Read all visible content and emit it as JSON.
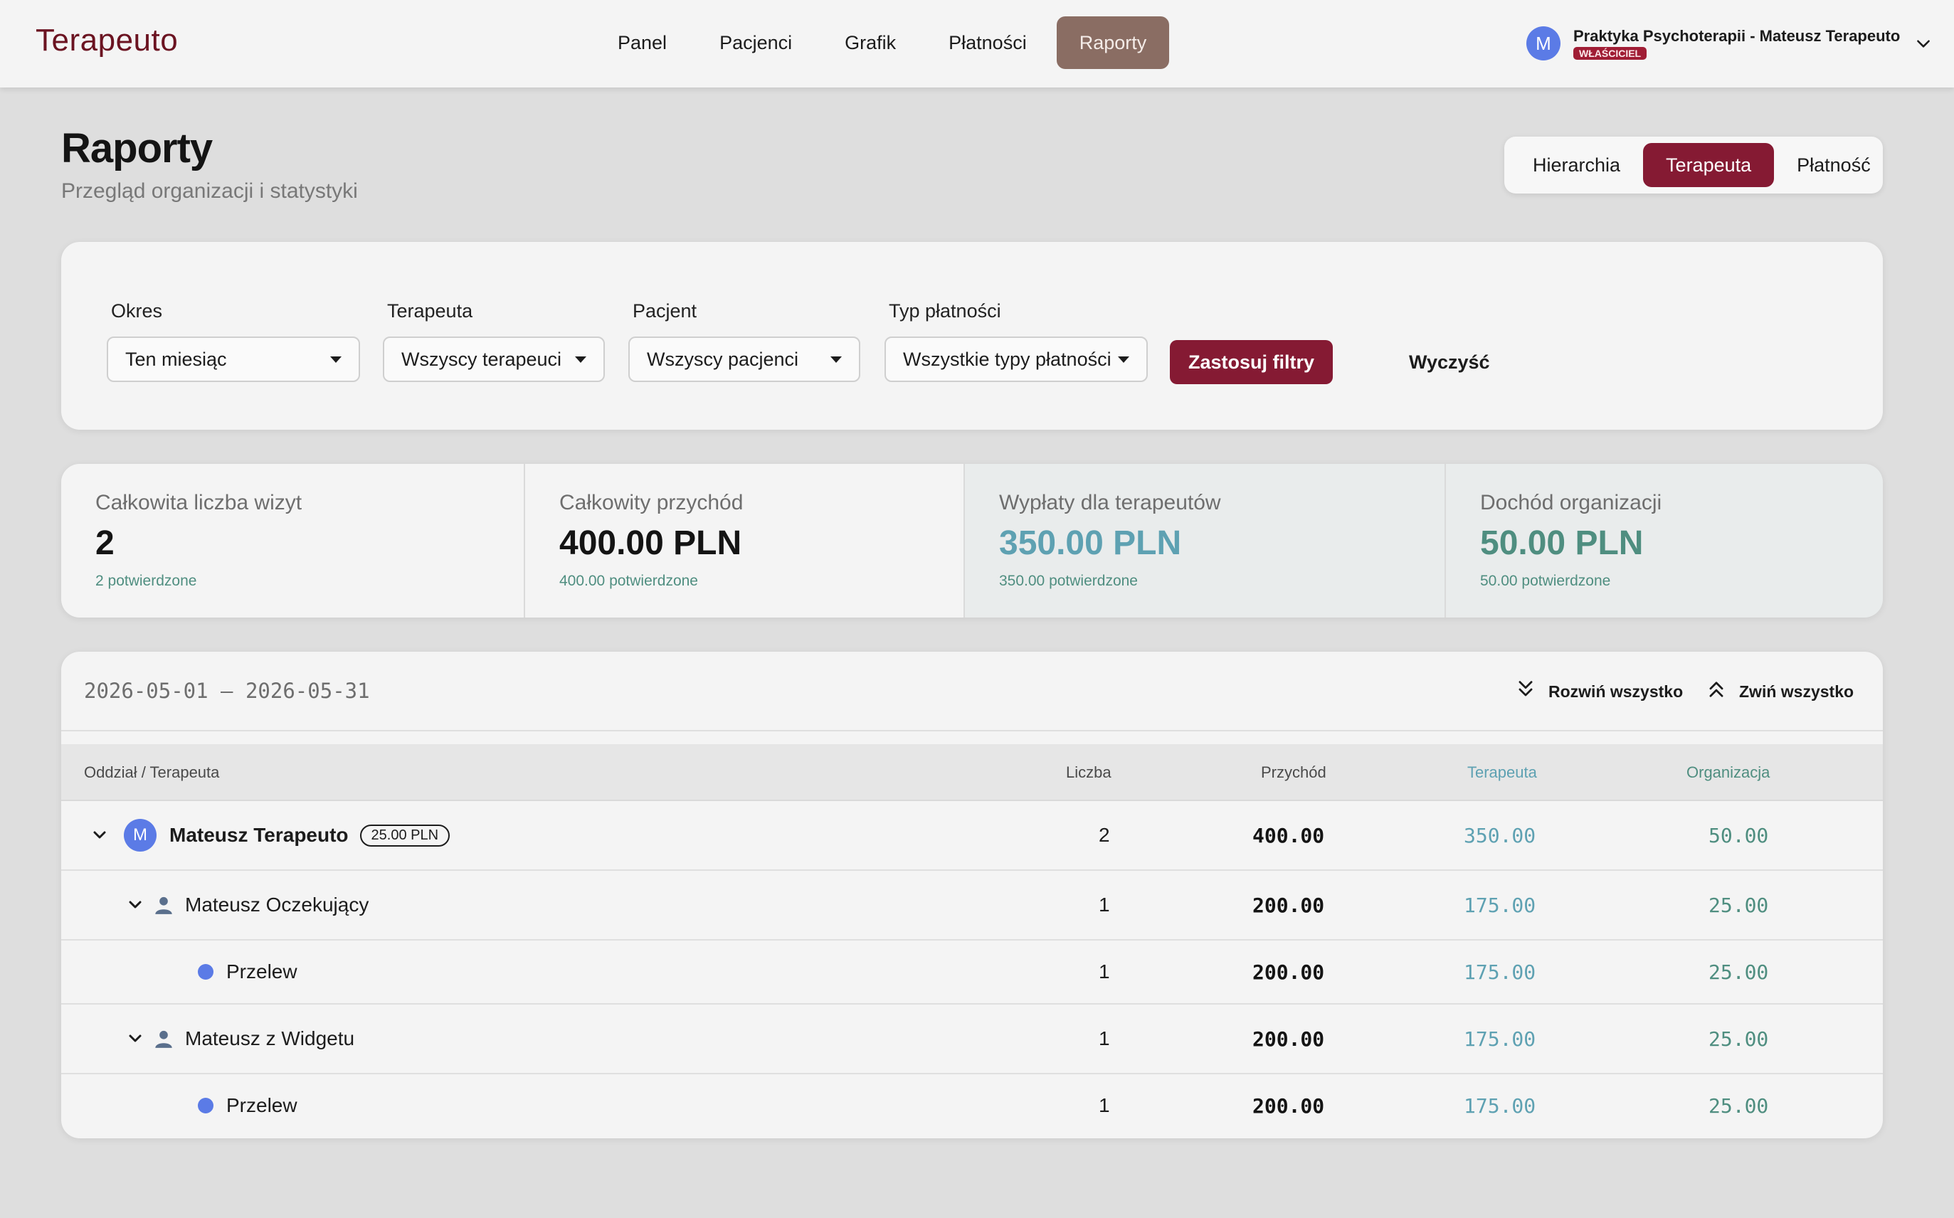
{
  "app": {
    "brand": "Terapeuto"
  },
  "nav": {
    "items": [
      {
        "label": "Panel"
      },
      {
        "label": "Pacjenci"
      },
      {
        "label": "Grafik"
      },
      {
        "label": "Płatności"
      },
      {
        "label": "Raporty",
        "active": true
      }
    ]
  },
  "account": {
    "initial": "M",
    "name": "Praktyka Psychoterapii - Mateusz Terapeuto",
    "role": "WŁAŚCICIEL"
  },
  "page": {
    "title": "Raporty",
    "subtitle": "Przegląd organizacji i statystyki"
  },
  "view_switch": {
    "options": [
      "Hierarchia",
      "Terapeuta",
      "Płatność"
    ],
    "active": "Terapeuta"
  },
  "filters": {
    "period": {
      "label": "Okres",
      "value": "Ten miesiąc"
    },
    "therapist": {
      "label": "Terapeuta",
      "value": "Wszyscy terapeuci"
    },
    "patient": {
      "label": "Pacjent",
      "value": "Wszyscy pacjenci"
    },
    "payment_type": {
      "label": "Typ płatności",
      "value": "Wszystkie typy płatności"
    },
    "apply_label": "Zastosuj filtry",
    "clear_label": "Wyczyść"
  },
  "stats": {
    "visits": {
      "label": "Całkowita liczba wizyt",
      "value": "2",
      "note": "2 potwierdzone"
    },
    "revenue": {
      "label": "Całkowity przychód",
      "value": "400.00 PLN",
      "note": "400.00 potwierdzone"
    },
    "payouts": {
      "label": "Wypłaty dla terapeutów",
      "value": "350.00 PLN",
      "note": "350.00 potwierdzone"
    },
    "org_income": {
      "label": "Dochód organizacji",
      "value": "50.00 PLN",
      "note": "50.00 potwierdzone"
    }
  },
  "report": {
    "date_range": "2026-05-01 – 2026-05-31",
    "expand_all": "Rozwiń wszystko",
    "collapse_all": "Zwiń wszystko",
    "columns": {
      "name": "Oddział / Terapeuta",
      "count": "Liczba",
      "revenue": "Przychód",
      "therapist": "Terapeuta",
      "organization": "Organizacja"
    },
    "therapist_row": {
      "initial": "M",
      "name": "Mateusz Terapeuto",
      "rate": "25.00 PLN",
      "count": "2",
      "revenue": "400.00",
      "therapist": "350.00",
      "organization": "50.00"
    },
    "patient_rows": [
      {
        "name": "Mateusz Oczekujący",
        "count": "1",
        "revenue": "200.00",
        "therapist": "175.00",
        "organization": "25.00",
        "payment": {
          "name": "Przelew",
          "count": "1",
          "revenue": "200.00",
          "therapist": "175.00",
          "organization": "25.00"
        }
      },
      {
        "name": "Mateusz z Widgetu",
        "count": "1",
        "revenue": "200.00",
        "therapist": "175.00",
        "organization": "25.00",
        "payment": {
          "name": "Przelew",
          "count": "1",
          "revenue": "200.00",
          "therapist": "175.00",
          "organization": "25.00"
        }
      }
    ]
  },
  "colors": {
    "brand": "#6b1321",
    "primary": "#851a33",
    "nav_active": "#8a6d63",
    "teal": "#5ea1b2",
    "green": "#4f8e80",
    "avatar": "#5b7be6"
  },
  "icons": {
    "account_menu": "chevron-down-icon",
    "expand_all": "double-chevron-down-icon",
    "collapse_all": "double-chevron-up-icon",
    "row_toggle": "chevron-down-icon",
    "patient": "person-icon",
    "payment": "dot-icon"
  }
}
